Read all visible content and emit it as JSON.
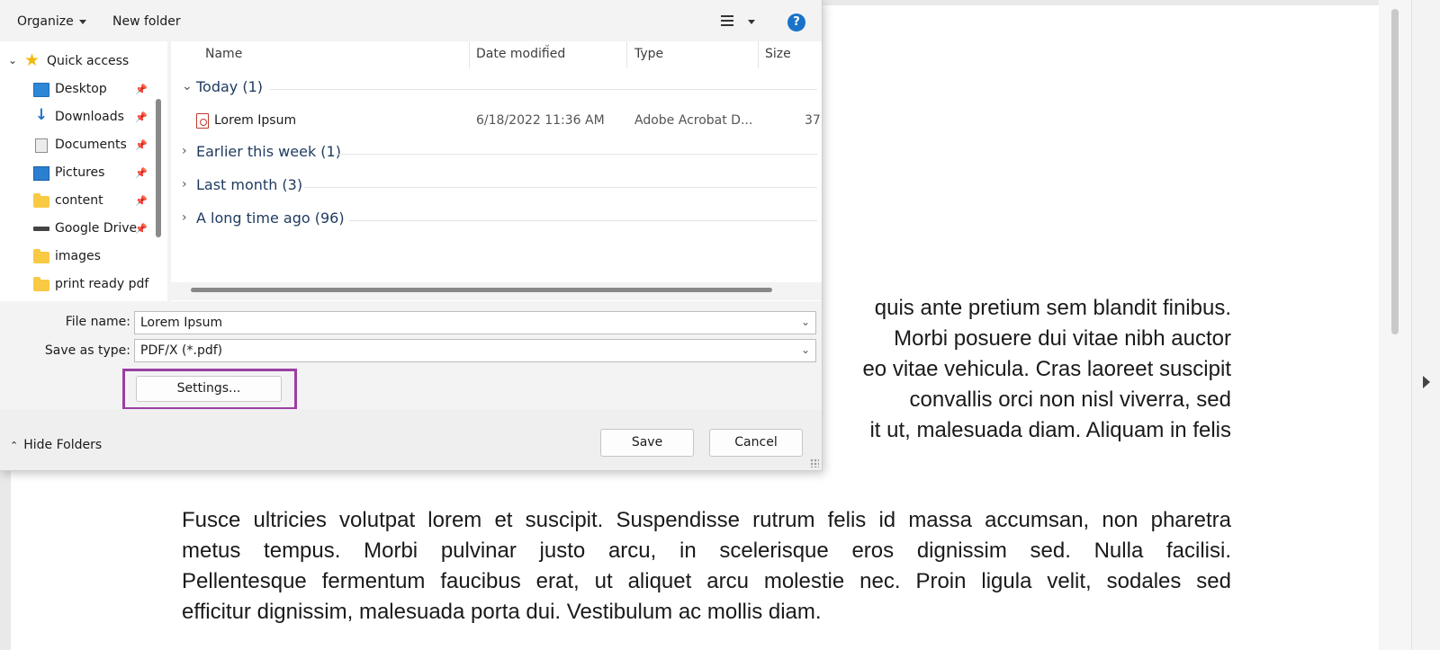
{
  "toolbar": {
    "organize_label": "Organize",
    "new_folder_label": "New folder",
    "help_label": "?"
  },
  "nav": {
    "quick_access": "Quick access",
    "items": [
      {
        "label": "Desktop",
        "icon": "desktop-icon"
      },
      {
        "label": "Downloads",
        "icon": "downloads-icon"
      },
      {
        "label": "Documents",
        "icon": "documents-icon"
      },
      {
        "label": "Pictures",
        "icon": "pictures-icon"
      },
      {
        "label": "content",
        "icon": "folder-icon"
      },
      {
        "label": "Google Drive",
        "icon": "drive-icon"
      },
      {
        "label": "images",
        "icon": "folder-icon"
      },
      {
        "label": "print ready pdf",
        "icon": "folder-icon"
      }
    ]
  },
  "files": {
    "columns": [
      "Name",
      "Date modified",
      "Type",
      "Size"
    ],
    "groups": [
      {
        "title": "Today (1)"
      },
      {
        "title": "Earlier this week (1)"
      },
      {
        "title": "Last month (3)"
      },
      {
        "title": "A long time ago (96)"
      }
    ],
    "rows": [
      {
        "name": "Lorem Ipsum",
        "date": "6/18/2022 11:36 AM",
        "type": "Adobe Acrobat D...",
        "size": "37"
      }
    ]
  },
  "form": {
    "file_name_label": "File name:",
    "file_name_value": "Lorem Ipsum",
    "save_type_label": "Save as type:",
    "save_type_value": "PDF/X (*.pdf)",
    "settings_label": "Settings..."
  },
  "footer": {
    "hide_folders_label": "Hide Folders",
    "save_label": "Save",
    "cancel_label": "Cancel"
  },
  "document": {
    "para1_lines": [
      "quis ante pretium sem blandit finibus.",
      "Morbi posuere dui vitae nibh auctor",
      "eo vitae vehicula. Cras laoreet suscipit",
      "convallis orci non nisl viverra, sed",
      "it ut, malesuada diam. Aliquam in felis"
    ],
    "para2_lines": [
      "Fusce ultricies volutpat lorem et suscipit. Suspendisse rutrum felis id massa accumsan, non pharetra",
      "metus tempus. Morbi pulvinar justo arcu, in scelerisque eros dignissim sed. Nulla facilisi.",
      "Pellentesque fermentum faucibus erat, ut aliquet arcu molestie nec. Proin ligula velit, sodales sed",
      "efficitur dignissim, malesuada porta dui. Vestibulum ac mollis diam."
    ]
  },
  "colors": {
    "highlight": "#9b3fa3",
    "accent": "#1a73c8",
    "pdf_icon": "#c0392b"
  }
}
